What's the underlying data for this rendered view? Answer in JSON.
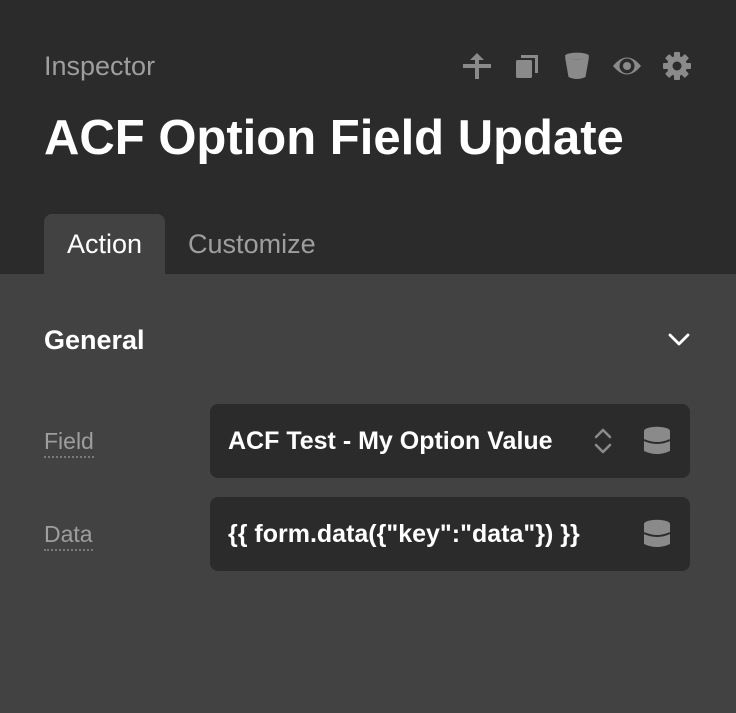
{
  "header": {
    "label": "Inspector",
    "title": "ACF Option Field Update",
    "toolbar": [
      {
        "name": "pin-icon"
      },
      {
        "name": "copy-icon"
      },
      {
        "name": "trash-icon"
      },
      {
        "name": "eye-icon"
      },
      {
        "name": "gear-icon"
      }
    ]
  },
  "tabs": [
    {
      "label": "Action",
      "active": true
    },
    {
      "label": "Customize",
      "active": false
    }
  ],
  "section": {
    "title": "General",
    "expanded": true
  },
  "fields": {
    "field": {
      "label": "Field",
      "value": "ACF Test - My Option Value"
    },
    "data": {
      "label": "Data",
      "value": "{{ form.data({\"key\":\"data\"}) }}"
    }
  },
  "colors": {
    "header_bg": "#2b2b2b",
    "body_bg": "#424242",
    "control_bg": "#2b2b2b",
    "icon": "#8a8a8a",
    "muted_text": "#9e9e9e",
    "text": "#ffffff"
  }
}
